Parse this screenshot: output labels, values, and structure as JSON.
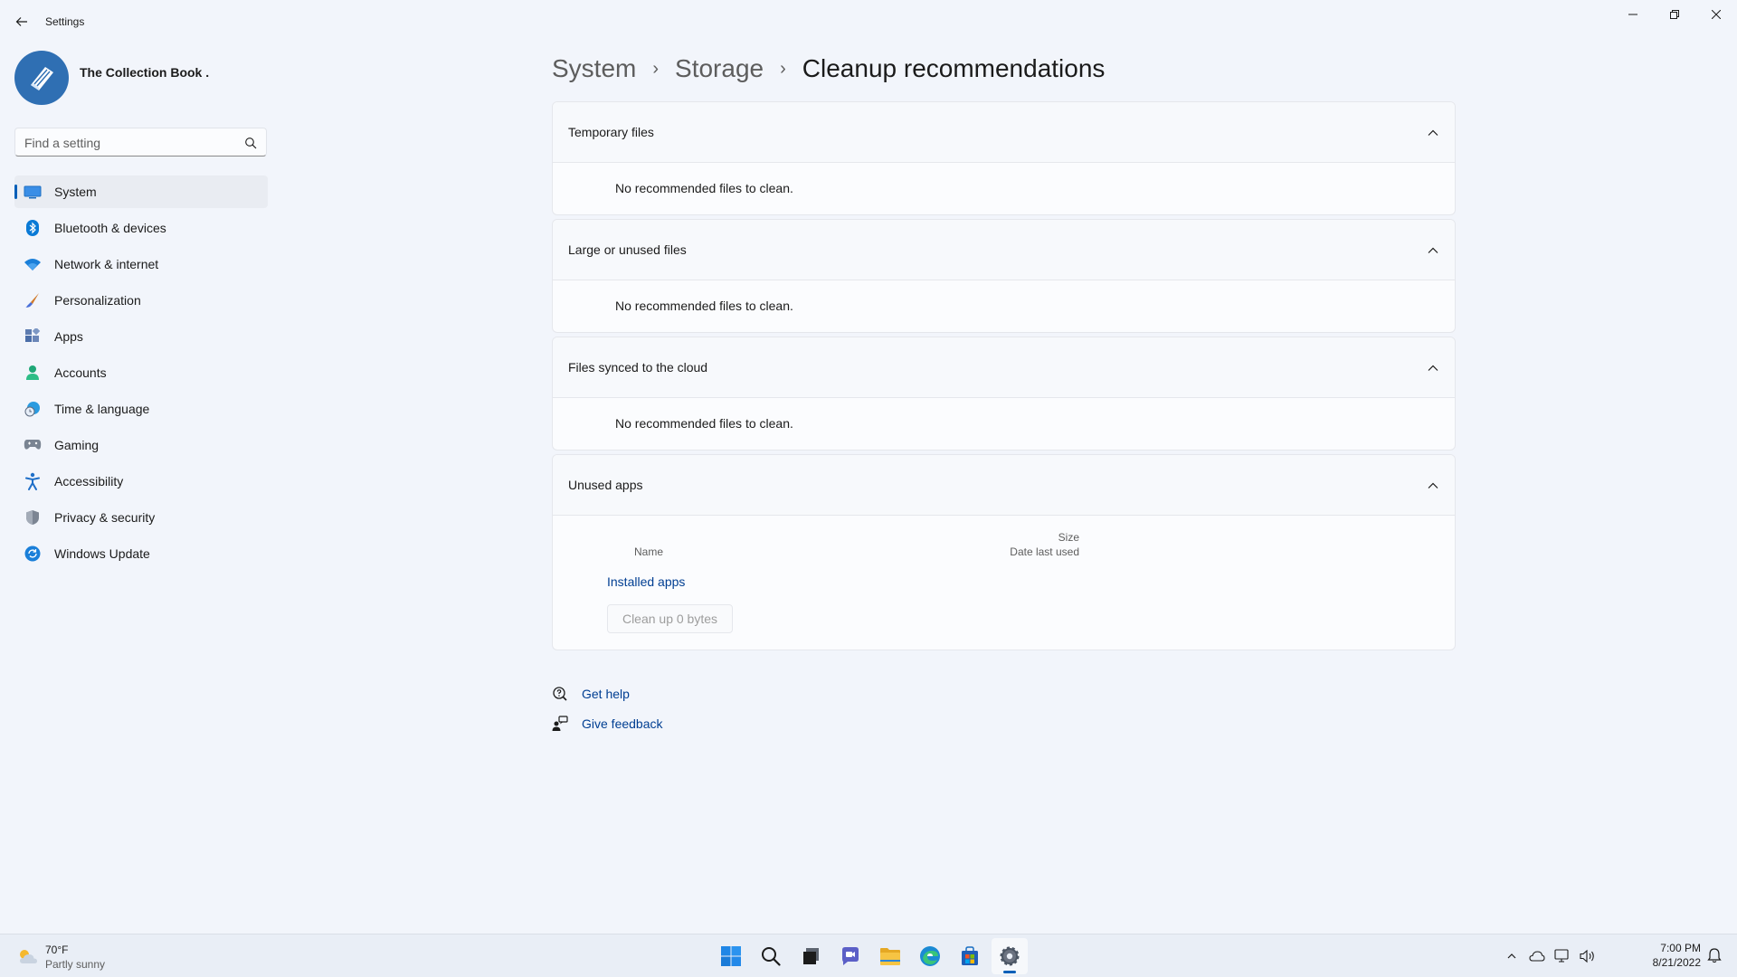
{
  "window": {
    "app_title": "Settings"
  },
  "profile": {
    "name": "The Collection Book ."
  },
  "search": {
    "placeholder": "Find a setting"
  },
  "sidebar": {
    "items": [
      {
        "label": "System",
        "icon": "system-icon"
      },
      {
        "label": "Bluetooth & devices",
        "icon": "bluetooth-icon"
      },
      {
        "label": "Network & internet",
        "icon": "wifi-icon"
      },
      {
        "label": "Personalization",
        "icon": "brush-icon"
      },
      {
        "label": "Apps",
        "icon": "apps-icon"
      },
      {
        "label": "Accounts",
        "icon": "account-icon"
      },
      {
        "label": "Time & language",
        "icon": "globe-clock-icon"
      },
      {
        "label": "Gaming",
        "icon": "gamepad-icon"
      },
      {
        "label": "Accessibility",
        "icon": "accessibility-icon"
      },
      {
        "label": "Privacy & security",
        "icon": "shield-icon"
      },
      {
        "label": "Windows Update",
        "icon": "update-icon"
      }
    ],
    "selected": "System"
  },
  "breadcrumb": {
    "items": [
      "System",
      "Storage"
    ],
    "current": "Cleanup recommendations"
  },
  "sections": {
    "temporary": {
      "title": "Temporary files",
      "message": "No recommended files to clean."
    },
    "large": {
      "title": "Large or unused files",
      "message": "No recommended files to clean."
    },
    "cloud": {
      "title": "Files synced to the cloud",
      "message": "No recommended files to clean."
    },
    "unused_apps": {
      "title": "Unused apps",
      "col_size": "Size",
      "col_name": "Name",
      "col_date": "Date last used",
      "installed_link": "Installed apps",
      "cleanup_button": "Clean up 0 bytes"
    }
  },
  "help": {
    "get_help": "Get help",
    "give_feedback": "Give feedback"
  },
  "taskbar": {
    "weather_temp": "70°F",
    "weather_desc": "Partly sunny",
    "apps": [
      "start-icon",
      "search-icon",
      "task-view-icon",
      "chat-icon",
      "file-explorer-icon",
      "edge-icon",
      "store-icon",
      "settings-icon"
    ],
    "time": "7:00 PM",
    "date": "8/21/2022"
  },
  "colors": {
    "accent": "#005fb8",
    "link": "#003e92",
    "background": "#f2f5fb",
    "card": "#fbfcfe"
  }
}
